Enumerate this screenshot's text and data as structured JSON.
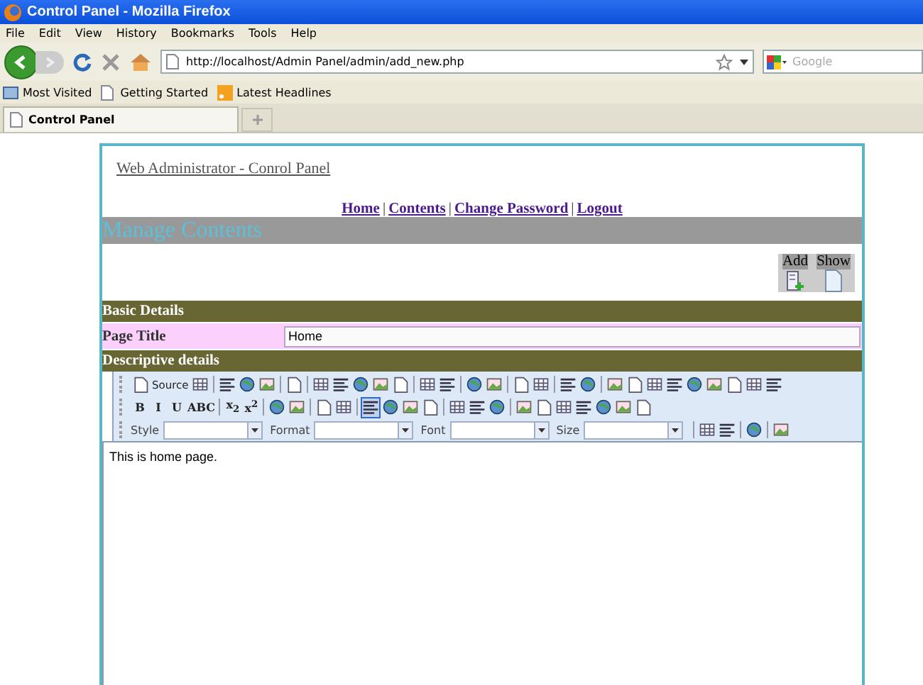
{
  "window": {
    "title": "Control Panel - Mozilla Firefox"
  },
  "menu": [
    "File",
    "Edit",
    "View",
    "History",
    "Bookmarks",
    "Tools",
    "Help"
  ],
  "address": {
    "url": "http://localhost/Admin Panel/admin/add_new.php"
  },
  "search": {
    "placeholder": "Google"
  },
  "bookmarks": [
    "Most Visited",
    "Getting Started",
    "Latest Headlines"
  ],
  "tabs": [
    {
      "label": "Control Panel",
      "selected": true
    }
  ],
  "page": {
    "heading": "Web Administrator - Conrol Panel",
    "nav": [
      {
        "kind": "link",
        "text": "Home"
      },
      {
        "kind": "sep",
        "text": "|"
      },
      {
        "kind": "link",
        "text": "Contents"
      },
      {
        "kind": "sep",
        "text": "|"
      },
      {
        "kind": "link",
        "text": "Change Password"
      },
      {
        "kind": "sep",
        "text": "|"
      },
      {
        "kind": "link",
        "text": "Logout"
      }
    ],
    "section_title": "Manage Contents",
    "actions": [
      {
        "label": "Add"
      },
      {
        "label": "Show"
      }
    ],
    "basic_header": "Basic Details",
    "fields": [
      {
        "label": "Page Title",
        "value": "Home"
      }
    ],
    "descriptive_header": "Descriptive details",
    "editor": {
      "toolbar": [
        [
          {
            "kind": "icon",
            "text": "Source",
            "on": false
          },
          {
            "kind": "icon",
            "on": false
          },
          {
            "kind": "sep"
          },
          {
            "kind": "icon",
            "on": false
          },
          {
            "kind": "icon",
            "on": false
          },
          {
            "kind": "icon",
            "on": false
          },
          {
            "kind": "sep"
          },
          {
            "kind": "icon",
            "on": false
          },
          {
            "kind": "sep"
          },
          {
            "kind": "icon",
            "on": false
          },
          {
            "kind": "icon",
            "on": false
          },
          {
            "kind": "icon",
            "on": false
          },
          {
            "kind": "icon",
            "on": false
          },
          {
            "kind": "icon",
            "on": false
          },
          {
            "kind": "sep"
          },
          {
            "kind": "icon",
            "on": false
          },
          {
            "kind": "icon",
            "on": false
          },
          {
            "kind": "sep"
          },
          {
            "kind": "icon",
            "on": false
          },
          {
            "kind": "icon",
            "on": false
          },
          {
            "kind": "sep"
          },
          {
            "kind": "icon",
            "on": false
          },
          {
            "kind": "icon",
            "on": false
          },
          {
            "kind": "sep"
          },
          {
            "kind": "icon",
            "on": false
          },
          {
            "kind": "icon",
            "on": false
          },
          {
            "kind": "sep"
          },
          {
            "kind": "icon",
            "on": false
          },
          {
            "kind": "icon",
            "on": false
          },
          {
            "kind": "icon",
            "on": false
          },
          {
            "kind": "icon",
            "on": false
          },
          {
            "kind": "icon",
            "on": false
          },
          {
            "kind": "icon",
            "on": false
          },
          {
            "kind": "icon",
            "on": false
          },
          {
            "kind": "icon",
            "on": false
          },
          {
            "kind": "icon",
            "on": false
          }
        ],
        [
          {
            "kind": "label",
            "text": "B",
            "on": false
          },
          {
            "kind": "label",
            "text": "I",
            "on": false
          },
          {
            "kind": "label",
            "text": "U",
            "on": false
          },
          {
            "kind": "label",
            "text": "ABC",
            "on": false
          },
          {
            "kind": "sep"
          },
          {
            "kind": "label",
            "text": "x$_{2}$",
            "on": false
          },
          {
            "kind": "label",
            "text": "x$^{2}$",
            "on": false
          },
          {
            "kind": "sep"
          },
          {
            "kind": "icon",
            "on": false
          },
          {
            "kind": "icon",
            "on": false
          },
          {
            "kind": "sep"
          },
          {
            "kind": "icon",
            "on": false
          },
          {
            "kind": "icon",
            "on": false
          },
          {
            "kind": "sep"
          },
          {
            "kind": "icon",
            "on": true
          },
          {
            "kind": "icon",
            "on": false
          },
          {
            "kind": "icon",
            "on": false
          },
          {
            "kind": "icon",
            "on": false
          },
          {
            "kind": "sep"
          },
          {
            "kind": "icon",
            "on": false
          },
          {
            "kind": "icon",
            "on": false
          },
          {
            "kind": "icon",
            "on": false
          },
          {
            "kind": "sep"
          },
          {
            "kind": "icon",
            "on": false
          },
          {
            "kind": "icon",
            "on": false
          },
          {
            "kind": "icon",
            "on": false
          },
          {
            "kind": "icon",
            "on": false
          },
          {
            "kind": "icon",
            "on": false
          },
          {
            "kind": "icon",
            "on": false
          },
          {
            "kind": "icon",
            "on": false
          }
        ],
        [
          {
            "kind": "combo",
            "text": "Style"
          },
          {
            "kind": "combo",
            "text": "Format"
          },
          {
            "kind": "combo",
            "text": "Font"
          },
          {
            "kind": "combo",
            "text": "Size"
          },
          {
            "kind": "sep"
          },
          {
            "kind": "icon",
            "on": false
          },
          {
            "kind": "icon",
            "on": false
          },
          {
            "kind": "sep"
          },
          {
            "kind": "icon",
            "on": false
          },
          {
            "kind": "sep"
          },
          {
            "kind": "icon",
            "on": false
          }
        ]
      ],
      "content": "This is home page."
    }
  }
}
